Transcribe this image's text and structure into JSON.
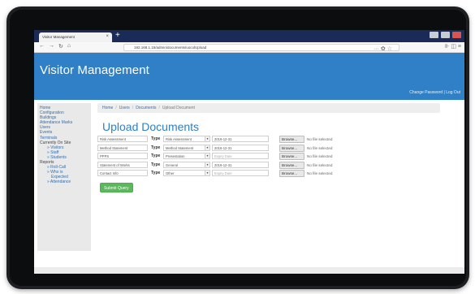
{
  "browser": {
    "tab_title": "Visitor Management",
    "tab_close": "×",
    "new_tab": "+",
    "url": "192.168.1.15/admin/documents/uocolUpload",
    "url_actions": "··· ✿ ☆",
    "toolbar_icons": "⊪ ◫ ≡"
  },
  "app": {
    "title": "Visitor Management",
    "header_links": "Change Password | Log Out"
  },
  "sidebar": {
    "items": [
      {
        "label": "Home",
        "kind": "link"
      },
      {
        "label": "Configuration",
        "kind": "link"
      },
      {
        "label": "Buildings",
        "kind": "link"
      },
      {
        "label": "Attendance Marks",
        "kind": "link"
      },
      {
        "label": "Users",
        "kind": "link"
      },
      {
        "label": "Events",
        "kind": "link"
      },
      {
        "label": "Terminals",
        "kind": "link"
      },
      {
        "label": "Currently On Site",
        "kind": "header"
      },
      {
        "label": "» Visitors",
        "kind": "sub"
      },
      {
        "label": "» Staff",
        "kind": "sub"
      },
      {
        "label": "» Students",
        "kind": "sub"
      },
      {
        "label": "Reports",
        "kind": "header"
      },
      {
        "label": "» Roll-Call",
        "kind": "sub"
      },
      {
        "label": "» Who is",
        "kind": "sub"
      },
      {
        "label": "Expected",
        "kind": "sub2"
      },
      {
        "label": "» Attendance",
        "kind": "sub"
      }
    ]
  },
  "breadcrumb": {
    "home": "Home",
    "users": "Users",
    "documents": "Documents",
    "current": "Upload Document",
    "separator": "/"
  },
  "page": {
    "title": "Upload Documents",
    "submit_label": "Submit Query"
  },
  "documents": {
    "type_label": "Type",
    "browse_label": "Browse...",
    "no_file_label": "No file selected",
    "rows": [
      {
        "name": "Risk Assessment",
        "type": "Risk Assessment",
        "date": "2016-12-31",
        "date_empty": false
      },
      {
        "name": "Method Statement",
        "type": "Method Statement",
        "date": "2016-12-31",
        "date_empty": false
      },
      {
        "name": "PPPS",
        "type": "Presentation",
        "date": "Expiry Date",
        "date_empty": true
      },
      {
        "name": "Statement of Works",
        "type": "General",
        "date": "2016-12-31",
        "date_empty": false
      },
      {
        "name": "Contact Info",
        "type": "Other",
        "date": "Expiry Date",
        "date_empty": true
      }
    ]
  },
  "colors": {
    "header_blue": "#2f80c6",
    "tab_bar": "#1a2b57",
    "submit_green": "#5cb85c",
    "link_blue": "#2f6fb1"
  }
}
